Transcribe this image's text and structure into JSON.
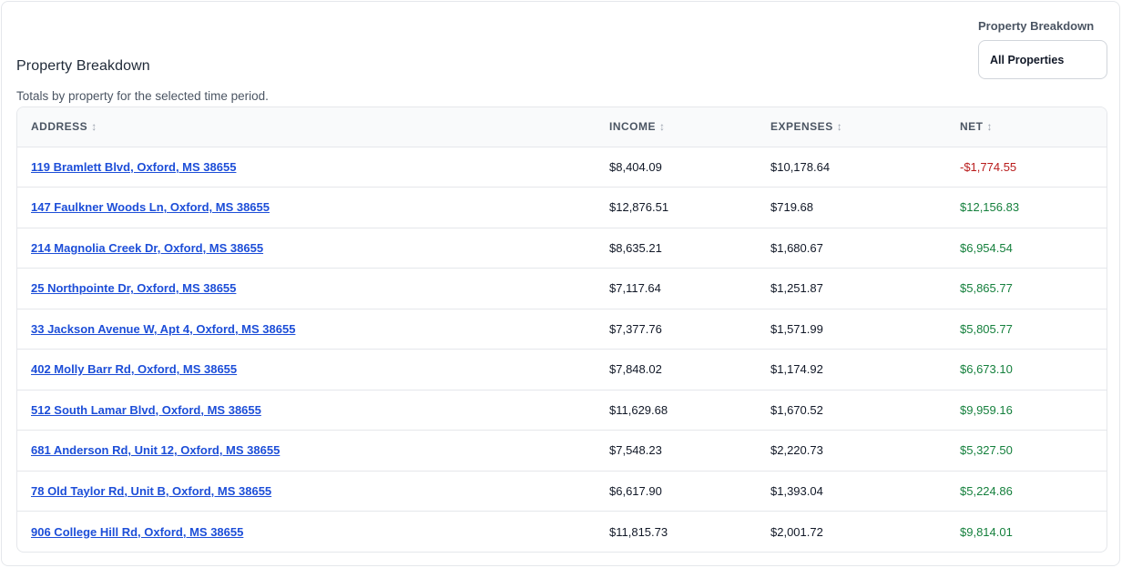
{
  "section": {
    "title": "Property Breakdown",
    "subtitle": "Totals by property for the selected time period."
  },
  "filter": {
    "label": "Property Breakdown",
    "selected": "All Properties"
  },
  "table": {
    "columns": [
      {
        "label": "ADDRESS",
        "sort_icon": "↕"
      },
      {
        "label": "INCOME",
        "sort_icon": "↕"
      },
      {
        "label": "EXPENSES",
        "sort_icon": "↕"
      },
      {
        "label": "NET",
        "sort_icon": "↕"
      }
    ],
    "rows": [
      {
        "address": "119 Bramlett Blvd, Oxford, MS 38655",
        "income": "$8,404.09",
        "expenses": "$10,178.64",
        "net": "-$1,774.55",
        "net_sign": "neg"
      },
      {
        "address": "147 Faulkner Woods Ln, Oxford, MS 38655",
        "income": "$12,876.51",
        "expenses": "$719.68",
        "net": "$12,156.83",
        "net_sign": "pos"
      },
      {
        "address": "214 Magnolia Creek Dr, Oxford, MS 38655",
        "income": "$8,635.21",
        "expenses": "$1,680.67",
        "net": "$6,954.54",
        "net_sign": "pos"
      },
      {
        "address": "25 Northpointe Dr, Oxford, MS 38655",
        "income": "$7,117.64",
        "expenses": "$1,251.87",
        "net": "$5,865.77",
        "net_sign": "pos"
      },
      {
        "address": "33 Jackson Avenue W, Apt 4, Oxford, MS 38655",
        "income": "$7,377.76",
        "expenses": "$1,571.99",
        "net": "$5,805.77",
        "net_sign": "pos"
      },
      {
        "address": "402 Molly Barr Rd, Oxford, MS 38655",
        "income": "$7,848.02",
        "expenses": "$1,174.92",
        "net": "$6,673.10",
        "net_sign": "pos"
      },
      {
        "address": "512 South Lamar Blvd, Oxford, MS 38655",
        "income": "$11,629.68",
        "expenses": "$1,670.52",
        "net": "$9,959.16",
        "net_sign": "pos"
      },
      {
        "address": "681 Anderson Rd, Unit 12, Oxford, MS 38655",
        "income": "$7,548.23",
        "expenses": "$2,220.73",
        "net": "$5,327.50",
        "net_sign": "pos"
      },
      {
        "address": "78 Old Taylor Rd, Unit B, Oxford, MS 38655",
        "income": "$6,617.90",
        "expenses": "$1,393.04",
        "net": "$5,224.86",
        "net_sign": "pos"
      },
      {
        "address": "906 College Hill Rd, Oxford, MS 38655",
        "income": "$11,815.73",
        "expenses": "$2,001.72",
        "net": "$9,814.01",
        "net_sign": "pos"
      }
    ]
  },
  "colors": {
    "link": "#1d4ed8",
    "net_positive": "#15803d",
    "net_negative": "#b91c1c",
    "border": "#e5e7eb",
    "header_bg": "#f9fafb"
  }
}
